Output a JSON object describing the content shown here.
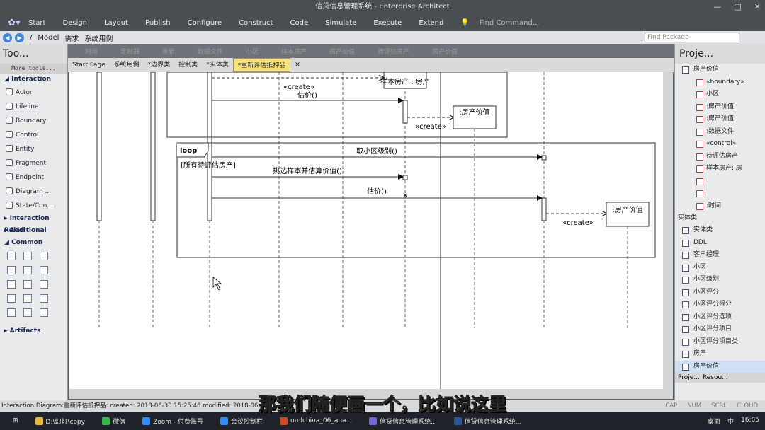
{
  "window": {
    "title": "信贷信息管理系统 - Enterprise Architect"
  },
  "menu": {
    "items": [
      "Start",
      "Design",
      "Layout",
      "Publish",
      "Configure",
      "Construct",
      "Code",
      "Simulate",
      "Execute",
      "Extend"
    ],
    "find": "Find Command..."
  },
  "address": {
    "crumbs": [
      "/",
      "Model",
      "需求",
      "系统用例"
    ],
    "find_placeholder": "Find Package"
  },
  "toolbox": {
    "title": "Too...",
    "more_tools": "More tools...",
    "interaction_header": "Interaction",
    "interaction_items": [
      "Actor",
      "Lifeline",
      "Boundary",
      "Control",
      "Entity",
      "Fragment",
      "Endpoint",
      "Diagram ...",
      "State/Con..."
    ],
    "other_sections": [
      "Interaction Relati",
      "Additional",
      "Common"
    ],
    "artifacts": "Artifacts"
  },
  "ghost_tabs": [
    "时间",
    "定时器",
    "重新",
    "数据文件",
    "小区",
    "样本房产",
    "房产价值",
    "待评估房产",
    "房产价值"
  ],
  "tabs": [
    "Start Page",
    "系统用例",
    "*边界类",
    "控制类",
    "*实体类",
    "*重新评估抵押品"
  ],
  "diagram": {
    "top_object": "样本房产 : 房产",
    "create_label": "«create»",
    "msg_estimate": "估价()",
    "obj_value1": ":房产价值",
    "create_label2": "«create»",
    "loop_label": "loop",
    "loop_guard": "[所有待评估房产]",
    "msg_level": "取小区级别()",
    "msg_select": "挑选样本并估算价值()",
    "msg_estimate2": "估价()",
    "create_label3": "«create»",
    "obj_value2": ":房产价值"
  },
  "project": {
    "title": "Proje...",
    "package": "房产价值",
    "items": [
      "«boundary»",
      "小区",
      ":房产价值",
      ":房产价值",
      ":数据文件",
      "«control»",
      "待评估房产",
      "样本房产: 房"
    ],
    "time_item": ":时间",
    "section": "实体类",
    "entity_items": [
      "实体类",
      "DDL",
      "客户经理",
      "小区",
      "小区级别",
      "小区评分",
      "小区评分得分",
      "小区评分选项",
      "小区评分项目",
      "小区评分项目类",
      "房产",
      "房产价值"
    ],
    "bottom_tabs": [
      "Proje...",
      "Resou..."
    ]
  },
  "status": {
    "text": "Interaction Diagram:重新评估抵押品:  created: 2018-06-30 15:25:46  modified: 2018-06",
    "flags": [
      "CAP",
      "NUM",
      "SCRL",
      "CLOUD"
    ]
  },
  "taskbar": {
    "apps": [
      "D:\\幻灯\\copy",
      "微信",
      "Zoom - 付费账号",
      "会议控制栏",
      "umlchina_06_ana...",
      "信贷信息管理系统...",
      "信贷信息管理系统..."
    ],
    "right": [
      "桌面",
      "中",
      "16:05"
    ]
  },
  "caption": "那我们随便画一个，比如说这里",
  "colors": {
    "accent": "#f6e27a",
    "caption": "#ffea3a"
  }
}
